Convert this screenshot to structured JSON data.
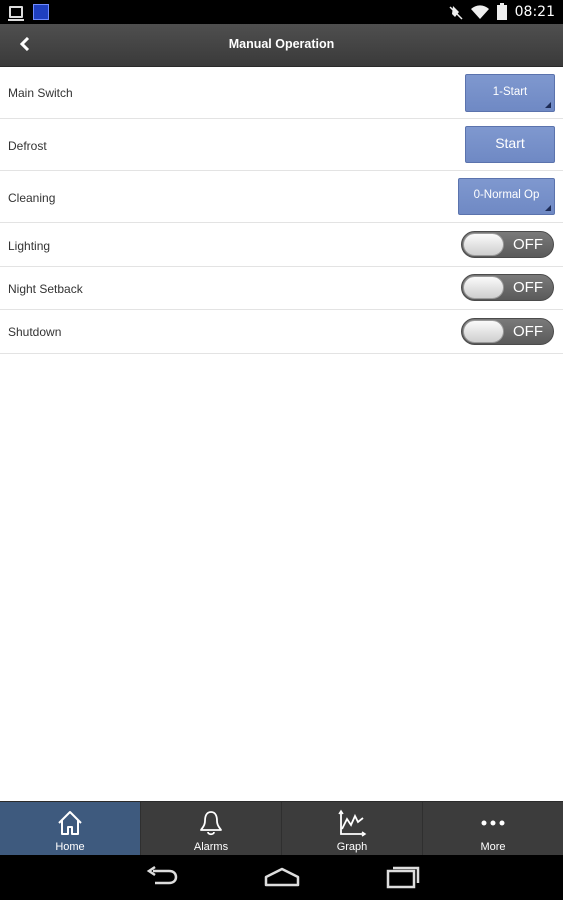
{
  "status_bar": {
    "time": "08:21",
    "left_icons": [
      "screen-notification-icon",
      "app-notification-icon"
    ],
    "right_icons": [
      "no-sound-icon",
      "wifi-icon",
      "battery-icon"
    ]
  },
  "header": {
    "title": "Manual Operation",
    "back_icon": "chevron-left-icon"
  },
  "rows": [
    {
      "label": "Main Switch",
      "control": "dropdown",
      "value": "1-Start"
    },
    {
      "label": "Defrost",
      "control": "button",
      "value": "Start"
    },
    {
      "label": "Cleaning",
      "control": "dropdown",
      "value": "0-Normal Op"
    },
    {
      "label": "Lighting",
      "control": "toggle",
      "value": "OFF"
    },
    {
      "label": "Night Setback",
      "control": "toggle",
      "value": "OFF"
    },
    {
      "label": "Shutdown",
      "control": "toggle",
      "value": "OFF"
    }
  ],
  "tabs": [
    {
      "label": "Home",
      "icon": "home-icon",
      "active": true
    },
    {
      "label": "Alarms",
      "icon": "bell-icon",
      "active": false
    },
    {
      "label": "Graph",
      "icon": "graph-icon",
      "active": false
    },
    {
      "label": "More",
      "icon": "more-icon",
      "active": false
    }
  ],
  "colors": {
    "header": "#444444",
    "accent_button": "#748ec8",
    "active_tab": "#3e5a7e",
    "tab_bar": "#3c3c3c"
  }
}
